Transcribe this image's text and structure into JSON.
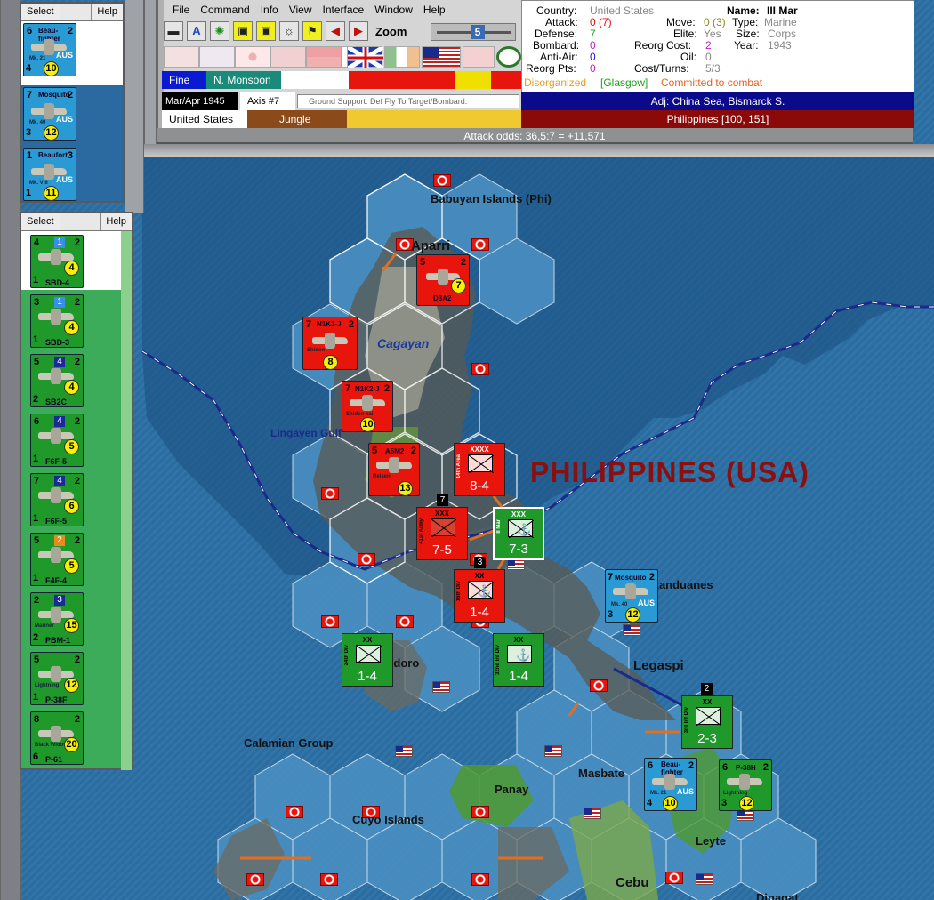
{
  "menu": [
    "File",
    "Command",
    "Info",
    "View",
    "Interface",
    "Window",
    "Help"
  ],
  "zoom": {
    "label": "Zoom",
    "level": "5"
  },
  "weather": {
    "weather": "Fine",
    "season": "N. Monsoon"
  },
  "turn": {
    "date": "Mar/Apr 1945",
    "phase": "Axis #7",
    "mission": "Ground Support: Def Fly To Target/Bombard."
  },
  "hex": {
    "owner": "United States",
    "terrain": "Jungle",
    "adjacent": "Adj: China Sea, Bismarck S.",
    "location": "Philippines [100, 151]"
  },
  "odds": "Attack odds: 36,5:7 = +11,571",
  "unit_info": {
    "country_label": "Country:",
    "country": "United States",
    "name_label": "Name:",
    "name": "III Mar",
    "attack_label": "Attack:",
    "attack": "0 (7)",
    "move_label": "Move:",
    "move": "0 (3)",
    "type_label": "Type:",
    "type": "Marine",
    "defense_label": "Defense:",
    "defense": "7",
    "elite_label": "Elite:",
    "elite": "Yes",
    "size_label": "Size:",
    "size": "Corps",
    "bombard_label": "Bombard:",
    "bombard": "0",
    "reorg_cost_label": "Reorg Cost:",
    "reorg_cost": "2",
    "year_label": "Year:",
    "year": "1943",
    "antiair_label": "Anti-Air:",
    "antiair": "0",
    "oil_label": "Oil:",
    "oil": "0",
    "reorg_pts_label": "Reorg Pts:",
    "reorg_pts": "0",
    "cost_turns_label": "Cost/Turns:",
    "cost_turns": "5/3",
    "status_disorganized": "Disorganized",
    "status_location": "[Glasgow]",
    "status_combat": "Committed to combat"
  },
  "panel1": {
    "select": "Select",
    "help": "Help",
    "units": [
      {
        "name": "Beau-fighter",
        "top": "6",
        "right": "2",
        "nation": "AUS",
        "mk": "Mk. 21",
        "bl": "4",
        "circle": "10"
      },
      {
        "name": "Mosquito",
        "top": "7",
        "right": "2",
        "nation": "AUS",
        "mk": "Mk. 40",
        "bl": "3",
        "circle": "12"
      },
      {
        "name": "Beaufort",
        "top": "1",
        "right": "3",
        "nation": "AUS",
        "mk": "Mk. VIII",
        "bl": "1",
        "circle": "11"
      }
    ]
  },
  "panel2": {
    "select": "Select",
    "help": "Help",
    "units": [
      {
        "name": "SBD-4",
        "top": "4",
        "badge": "1",
        "right": "2",
        "bl": "1",
        "circle": "4",
        "badge_color": "#3a8ee8"
      },
      {
        "name": "SBD-3",
        "top": "3",
        "badge": "1",
        "right": "2",
        "bl": "1",
        "circle": "4",
        "badge_color": "#3a8ee8"
      },
      {
        "name": "SB2C",
        "top": "5",
        "badge": "4",
        "right": "2",
        "bl": "2",
        "circle": "4",
        "badge_color": "#1a2a9a"
      },
      {
        "name": "F6F-5",
        "top": "6",
        "badge": "4",
        "right": "2",
        "bl": "1",
        "circle": "5",
        "badge_color": "#1a2a9a"
      },
      {
        "name": "F6F-5",
        "top": "7",
        "badge": "4",
        "right": "2",
        "bl": "1",
        "circle": "6",
        "badge_color": "#1a2a9a"
      },
      {
        "name": "F4F-4",
        "top": "5",
        "badge": "2",
        "right": "2",
        "bl": "1",
        "circle": "5",
        "badge_color": "#e88a20"
      },
      {
        "name": "PBM-1",
        "top": "2",
        "badge": "3",
        "right": "",
        "bl": "2",
        "circle": "15",
        "badge_color": "#1a2a9a",
        "sub": "Mariner"
      },
      {
        "name": "P-38F",
        "top": "5",
        "badge": "",
        "right": "2",
        "bl": "1",
        "circle": "12",
        "badge_color": "",
        "sub": "Lightning"
      },
      {
        "name": "P-61",
        "top": "8",
        "badge": "",
        "right": "2",
        "bl": "6",
        "circle": "20",
        "badge_color": "",
        "sub": "Black Widow"
      }
    ]
  },
  "map": {
    "labels": {
      "babuyan": "Babuyan Islands (Phi)",
      "aparri": "Aparri",
      "cagayan": "Cagayan",
      "lingayen": "Lingayen Gulf",
      "country": "PHILIPPINES (USA)",
      "catanduanes": "Catanduanes",
      "legaspi": "Legaspi",
      "mindoro": "Mindoro",
      "calamian": "Calamian Group",
      "masbate": "Masbate",
      "panay": "Panay",
      "cuyo": "Cuyo Islands",
      "leyte": "Leyte",
      "cebu": "Cebu",
      "dinagat": "Dinagat"
    },
    "air_counters": [
      {
        "name": "D3A2",
        "top": "5",
        "right": "2",
        "circle": "7"
      },
      {
        "name": "N1K1-J",
        "top": "7",
        "right": "2",
        "circle": "8",
        "sub": "Shiden"
      },
      {
        "name": "N1K2-J",
        "top": "7",
        "right": "2",
        "circle": "10",
        "sub": "Shiden-kai"
      },
      {
        "name": "A6M2",
        "top": "5",
        "right": "2",
        "circle": "13",
        "sub": "Reisen"
      }
    ],
    "allied_air": [
      {
        "name": "Mosquito",
        "top": "7",
        "right": "2",
        "nation": "AUS",
        "mk": "Mk. 40",
        "bl": "3",
        "circle": "12"
      },
      {
        "name": "Beau-fighter",
        "top": "6",
        "right": "2",
        "nation": "AUS",
        "mk": "Mk. 21",
        "bl": "4",
        "circle": "10"
      },
      {
        "name": "P-38H",
        "top": "6",
        "right": "2",
        "sub": "Lightning",
        "bl": "3",
        "circle": "12"
      }
    ],
    "ground": [
      {
        "size": "XXXX",
        "val": "8-4",
        "side": "14th Area"
      },
      {
        "size": "XXX",
        "val": "7-5",
        "side": "41st Army"
      },
      {
        "size": "XXX",
        "val": "7-3",
        "side": "III Mar"
      },
      {
        "size": "XX",
        "val": "1-4",
        "side": "16th Div"
      },
      {
        "size": "XX",
        "val": "1-4",
        "side": "24th Div"
      },
      {
        "size": "XX",
        "val": "1-4",
        "side": "32nd Inf Div"
      },
      {
        "size": "XX",
        "val": "2-3",
        "side": "3rd Inf Div"
      }
    ],
    "stacks": [
      "7",
      "3",
      "2"
    ]
  },
  "colors": {
    "japan_red": "#e8150c",
    "allied_green": "#1f9a2a",
    "aus_blue": "#2a9ad4",
    "sea_blue": "#2f73a8",
    "land_green": "#4a9a2c"
  }
}
